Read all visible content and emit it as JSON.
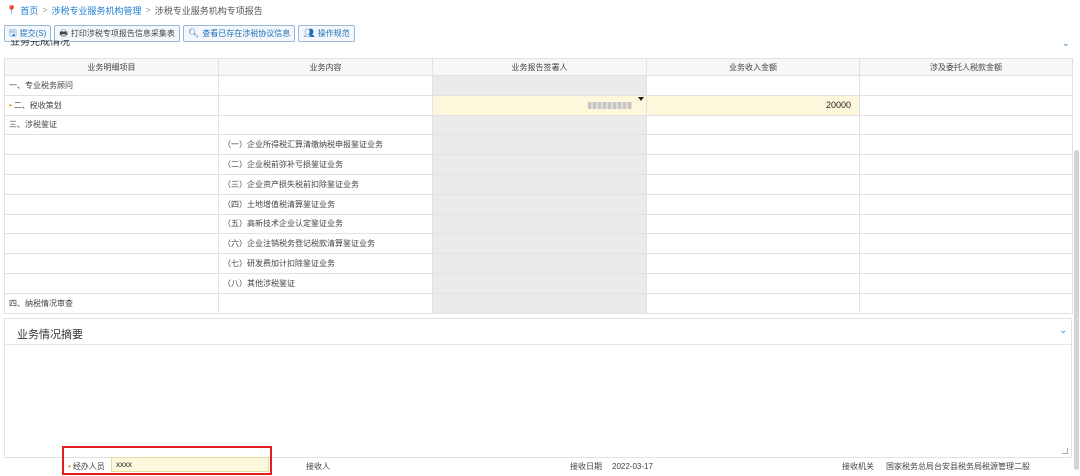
{
  "breadcrumb": {
    "home": "首页",
    "level1": "涉税专业服务机构管理",
    "current": "涉税专业服务机构专项报告"
  },
  "toolbar": {
    "submit": "提交(S)",
    "print": "打印涉税专项报告信息采集表",
    "view_agreement": "查看已存在涉税协议信息",
    "guide": "操作规范"
  },
  "section1": {
    "title": "业务完成情况"
  },
  "table": {
    "headers": [
      "业务明细项目",
      "业务内容",
      "业务报告签署人",
      "业务收入金额",
      "涉及委托人税款金额"
    ],
    "rows": [
      {
        "item": "一、专业税务顾问",
        "content": ""
      },
      {
        "item": "二、税收策划",
        "content": "",
        "required": true,
        "income": "20000"
      },
      {
        "item": "三、涉税鉴证",
        "content": ""
      },
      {
        "item": "",
        "content": "（一）企业所得税汇算清缴纳税申报鉴证业务"
      },
      {
        "item": "",
        "content": "（二）企业税前弥补亏损鉴证业务"
      },
      {
        "item": "",
        "content": "（三）企业资产损失税前扣除鉴证业务"
      },
      {
        "item": "",
        "content": "（四）土地增值税清算鉴证业务"
      },
      {
        "item": "",
        "content": "（五）高新技术企业认定鉴证业务"
      },
      {
        "item": "",
        "content": "（六）企业注销税务登记税款清算鉴证业务"
      },
      {
        "item": "",
        "content": "（七）研发费加计扣除鉴证业务"
      },
      {
        "item": "",
        "content": "（八）其他涉税鉴证"
      },
      {
        "item": "四、纳税情况审查",
        "content": ""
      }
    ]
  },
  "summary": {
    "title": "业务情况摘要"
  },
  "footer": {
    "handler_label": "经办人员",
    "handler_value": "xxxx",
    "receiver_label": "接收人",
    "receive_date_label": "接收日期",
    "receive_date_value": "2022-03-17",
    "receive_org_label": "接收机关",
    "receive_org_value": "国家税务总局台安县税务局税源管理二股"
  },
  "colors": {
    "accent": "#1e7fd6",
    "highlight": "#e02020",
    "editable_bg": "#fdf8dc",
    "readonly_bg": "#ebebeb"
  }
}
